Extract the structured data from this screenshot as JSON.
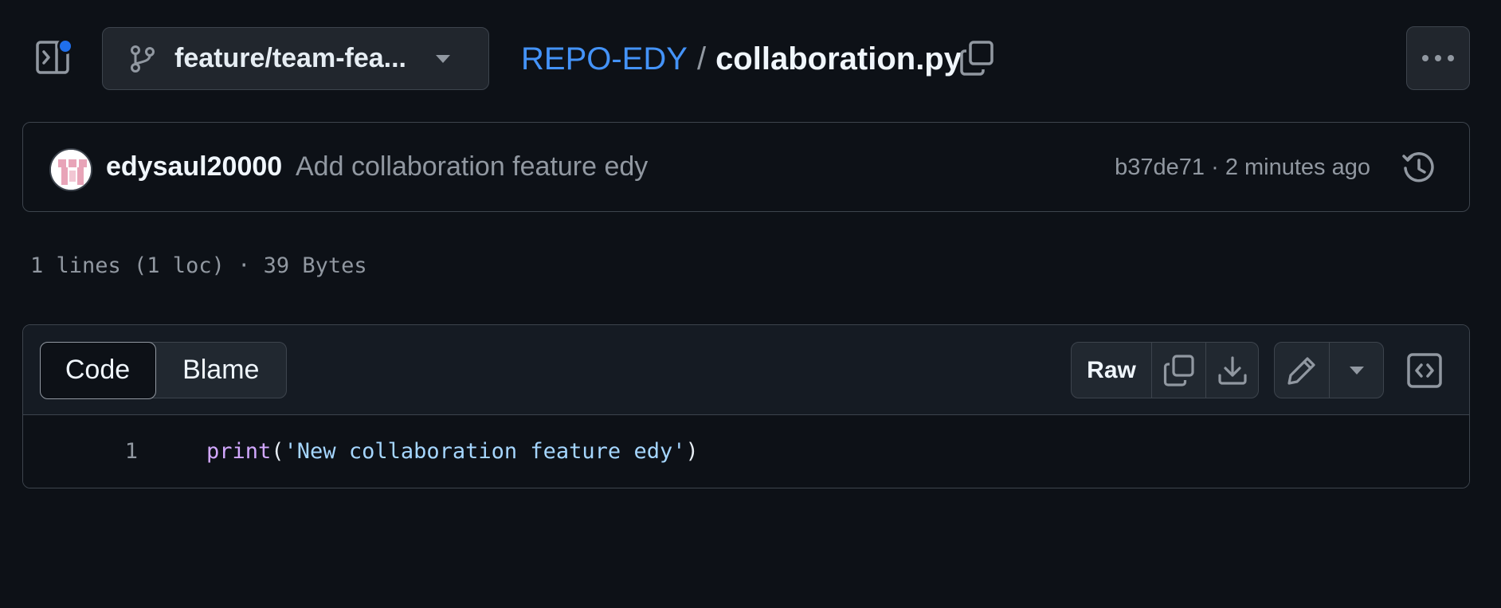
{
  "header": {
    "sidebar_toggle_icon": "sidebar-expand-icon",
    "branch": {
      "label": "feature/team-fea...",
      "icon": "git-branch-icon"
    },
    "breadcrumb": {
      "repo": "REPO-EDY",
      "separator": "/",
      "file": "collaboration.py"
    },
    "copy_path_icon": "copy-icon",
    "more_icon": "kebab-horizontal-icon"
  },
  "commit": {
    "author": "edysaul20000",
    "message": "Add collaboration feature edy",
    "sha": "b37de71",
    "separator": "·",
    "time": "2 minutes ago",
    "history_icon": "history-icon"
  },
  "file_info": "1 lines (1 loc) · 39 Bytes",
  "code_view": {
    "tabs": {
      "code": "Code",
      "blame": "Blame"
    },
    "actions": {
      "raw": "Raw",
      "copy_icon": "copy-icon",
      "download_icon": "download-icon",
      "edit_icon": "pencil-icon",
      "more_edit_icon": "triangle-down-icon",
      "symbols_icon": "code-square-icon"
    },
    "lines": [
      {
        "number": "1",
        "func": "print",
        "open": "(",
        "string": "'New collaboration feature edy'",
        "close": ")"
      }
    ]
  },
  "colors": {
    "background": "#0d1117",
    "link": "#4493f8",
    "notification_dot": "#1f6feb",
    "syntax_function": "#d2a8ff",
    "syntax_string": "#a5d6ff"
  }
}
